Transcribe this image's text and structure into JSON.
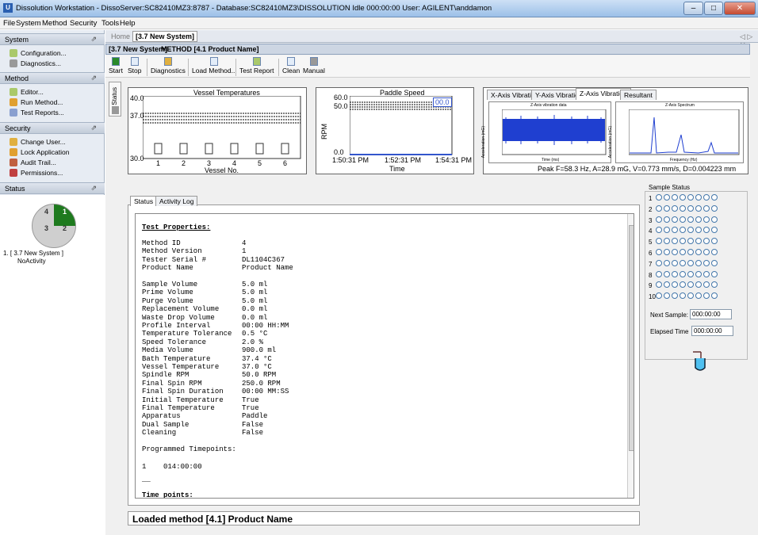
{
  "window": {
    "title": "Dissolution Workstation - DissoServer:SC82410MZ3:8787 - Database:SC82410MZ3\\DISSOLUTION   Idle 000:00:00  User: AGILENT\\anddamon",
    "app_icon": "U"
  },
  "menu": [
    "File",
    "System",
    "Method",
    "Security",
    "Tools",
    "Help"
  ],
  "sidebar": {
    "system": {
      "header": "System",
      "items": [
        "Configuration...",
        "Diagnostics..."
      ]
    },
    "method": {
      "header": "Method",
      "items": [
        "Editor...",
        "Run Method...",
        "Test Reports..."
      ]
    },
    "security": {
      "header": "Security",
      "items": [
        "Change User...",
        "Lock Application",
        "Audit Trail...",
        "Permissions..."
      ]
    },
    "status": {
      "header": "Status",
      "pie": [
        "4",
        "1",
        "3",
        "2"
      ],
      "entry1": "1. [ 3.7 New System ]",
      "entry2": "NoActivity"
    }
  },
  "doc": {
    "home": "Home",
    "tab": "[3.7 New System]",
    "nav": "◁ ▷ ✕",
    "system": "[3.7 New System]",
    "method": "METHOD [4.1 Product Name]"
  },
  "toolbar": [
    "Start",
    "Stop",
    "Diagnostics",
    "Load Method...",
    "Test Report",
    "Clean",
    "Manual"
  ],
  "status_vtab": "Status",
  "vessel_chart": {
    "title": "Vessel Temperatures",
    "y_ticks": [
      "40.0",
      "37.0",
      "30.0"
    ],
    "x_ticks": [
      "1",
      "2",
      "3",
      "4",
      "5",
      "6"
    ],
    "xlabel": "Vessel No."
  },
  "paddle_chart": {
    "title": "Paddle Speed",
    "y_ticks": [
      "60.0",
      "50.0",
      "0.0"
    ],
    "ylabel": "RPM",
    "x_ticks": [
      "1:50:31 PM",
      "1:52:31 PM",
      "1:54:31 PM"
    ],
    "xlabel": "Time",
    "value": "00.0"
  },
  "vibration": {
    "tabs": [
      "X-Axis Vibration",
      "Y-Axis Vibration",
      "Z-Axis Vibration",
      "Resultant"
    ],
    "left_title": "Z-Axis vibration data",
    "left_xlabel": "Time (ms)",
    "left_ylabel": "Acceleration (mG)",
    "right_title": "Z-Axis Spectrum",
    "right_xlabel": "Frequency (Hz)",
    "right_ylabel": "Acceleration (mG)",
    "summary": "Peak F=58.3 Hz, A=28.9 mG, V=0.773 mm/s, D=0.004223 mm"
  },
  "tabs": [
    "Status",
    "Activity Log"
  ],
  "report": {
    "heading": "Test Properties:",
    "props": [
      [
        "Method ID",
        "4"
      ],
      [
        "Method Version",
        "1"
      ],
      [
        "Tester Serial #",
        "DL1104C367"
      ],
      [
        "Product Name",
        "Product Name"
      ],
      [
        "",
        ""
      ],
      [
        "Sample Volume",
        "5.0 ml"
      ],
      [
        "Prime Volume",
        "5.0 ml"
      ],
      [
        "Purge Volume",
        "5.0 ml"
      ],
      [
        "Replacement Volume",
        "0.0 ml"
      ],
      [
        "Waste Drop Volume",
        "0.0 ml"
      ],
      [
        "Profile Interval",
        "00:00 HH:MM"
      ],
      [
        "Temperature Tolerance",
        "0.5 °C"
      ],
      [
        "Speed Tolerance",
        "2.0 %"
      ],
      [
        "Media Volume",
        "900.0 ml"
      ],
      [
        "Bath Temperature",
        "37.4 °C"
      ],
      [
        "Vessel Temperature",
        "37.0 °C"
      ],
      [
        "Spindle RPM",
        "50.0 RPM"
      ],
      [
        "Final Spin RPM",
        "250.0 RPM"
      ],
      [
        "Final Spin Duration",
        "00:00 MM:SS"
      ],
      [
        "Initial Temperature",
        "True"
      ],
      [
        "Final Temperature",
        "True"
      ],
      [
        "Apparatus",
        "Paddle"
      ],
      [
        "Dual Sample",
        "False"
      ],
      [
        "Cleaning",
        "False"
      ]
    ],
    "prog_heading": "Programmed Timepoints:",
    "prog_row": "1    014:00:00",
    "dash": "__",
    "tp_heading": "Time points:"
  },
  "loaded": "Loaded method [4.1] Product Name",
  "sample_status": {
    "title": "Sample Status",
    "rows": [
      "1",
      "2",
      "3",
      "4",
      "5",
      "6",
      "7",
      "8",
      "9",
      "10"
    ],
    "next_label": "Next Sample:",
    "next_value": "000:00:00",
    "elapsed_label": "Elapsed Time",
    "elapsed_value": "000:00:00"
  }
}
